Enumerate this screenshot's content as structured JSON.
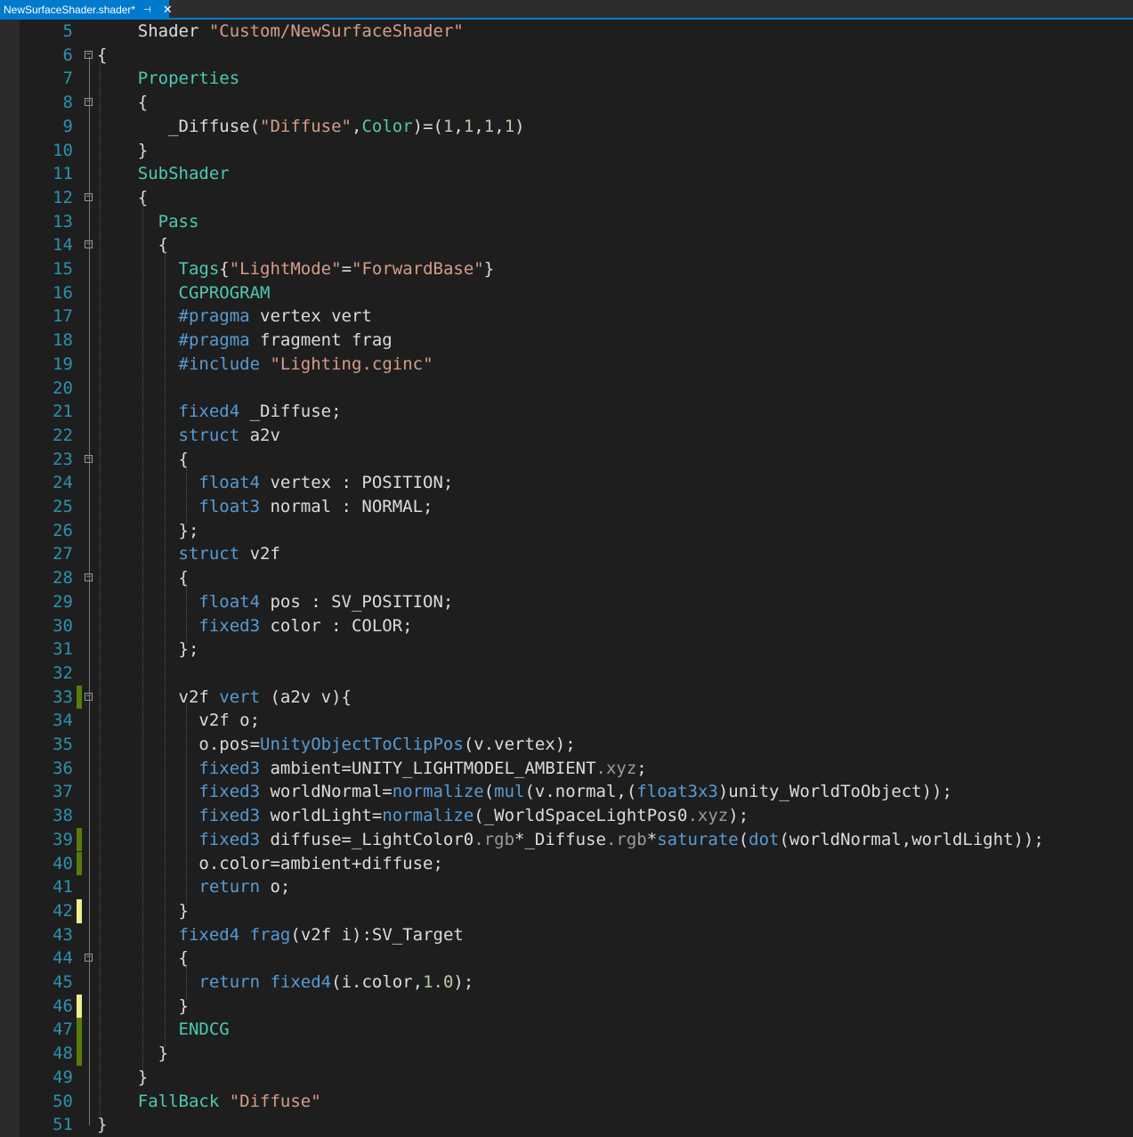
{
  "tab": {
    "title": "NewSurfaceShader.shader*",
    "pin_glyph": "⊣",
    "close_glyph": "✕"
  },
  "lines": [
    {
      "n": "5",
      "fold": null,
      "change": null,
      "tokens": [
        [
          "",
          "    "
        ],
        [
          "",
          "Shader "
        ],
        [
          "s",
          "\"Custom/NewSurfaceShader\""
        ]
      ]
    },
    {
      "n": "6",
      "fold": "⊟",
      "change": null,
      "tokens": [
        [
          "",
          "{"
        ]
      ]
    },
    {
      "n": "7",
      "fold": null,
      "change": null,
      "tokens": [
        [
          "",
          "    "
        ],
        [
          "t",
          "Properties"
        ]
      ]
    },
    {
      "n": "8",
      "fold": "⊟",
      "change": null,
      "tokens": [
        [
          "",
          "    {"
        ]
      ]
    },
    {
      "n": "9",
      "fold": null,
      "change": null,
      "tokens": [
        [
          "",
          "       "
        ],
        [
          "",
          "_Diffuse("
        ],
        [
          "s",
          "\"Diffuse\""
        ],
        [
          "",
          ","
        ],
        [
          "t",
          "Color"
        ],
        [
          "",
          ")=("
        ],
        [
          "n",
          "1"
        ],
        [
          "",
          ","
        ],
        [
          "n",
          "1"
        ],
        [
          "",
          ","
        ],
        [
          "n",
          "1"
        ],
        [
          "",
          ","
        ],
        [
          "n",
          "1"
        ],
        [
          "",
          ")"
        ]
      ]
    },
    {
      "n": "10",
      "fold": null,
      "change": null,
      "tokens": [
        [
          "",
          "    }"
        ]
      ]
    },
    {
      "n": "11",
      "fold": null,
      "change": null,
      "tokens": [
        [
          "",
          "    "
        ],
        [
          "t",
          "SubShader"
        ]
      ]
    },
    {
      "n": "12",
      "fold": "⊟",
      "change": null,
      "tokens": [
        [
          "",
          "    {"
        ]
      ]
    },
    {
      "n": "13",
      "fold": null,
      "change": null,
      "tokens": [
        [
          "",
          "      "
        ],
        [
          "t",
          "Pass"
        ]
      ]
    },
    {
      "n": "14",
      "fold": "⊟",
      "change": null,
      "tokens": [
        [
          "",
          "      {"
        ]
      ]
    },
    {
      "n": "15",
      "fold": null,
      "change": null,
      "tokens": [
        [
          "",
          "        "
        ],
        [
          "t",
          "Tags"
        ],
        [
          "",
          "{"
        ],
        [
          "s",
          "\"LightMode\""
        ],
        [
          "",
          "="
        ],
        [
          "s",
          "\"ForwardBase\""
        ],
        [
          "",
          "}"
        ]
      ]
    },
    {
      "n": "16",
      "fold": null,
      "change": null,
      "tokens": [
        [
          "",
          "        "
        ],
        [
          "t",
          "CGPROGRAM"
        ]
      ]
    },
    {
      "n": "17",
      "fold": null,
      "change": null,
      "tokens": [
        [
          "",
          "        "
        ],
        [
          "k",
          "#pragma"
        ],
        [
          "",
          " vertex vert"
        ]
      ]
    },
    {
      "n": "18",
      "fold": null,
      "change": null,
      "tokens": [
        [
          "",
          "        "
        ],
        [
          "k",
          "#pragma"
        ],
        [
          "",
          " fragment frag"
        ]
      ]
    },
    {
      "n": "19",
      "fold": null,
      "change": null,
      "tokens": [
        [
          "",
          "        "
        ],
        [
          "k",
          "#include"
        ],
        [
          "",
          " "
        ],
        [
          "s",
          "\"Lighting.cginc\""
        ]
      ]
    },
    {
      "n": "20",
      "fold": null,
      "change": null,
      "tokens": []
    },
    {
      "n": "21",
      "fold": null,
      "change": null,
      "tokens": [
        [
          "",
          "        "
        ],
        [
          "k",
          "fixed4"
        ],
        [
          "",
          " _Diffuse;"
        ]
      ]
    },
    {
      "n": "22",
      "fold": null,
      "change": null,
      "tokens": [
        [
          "",
          "        "
        ],
        [
          "k",
          "struct"
        ],
        [
          "",
          " a2v"
        ]
      ]
    },
    {
      "n": "23",
      "fold": "⊟",
      "change": null,
      "tokens": [
        [
          "",
          "        {"
        ]
      ]
    },
    {
      "n": "24",
      "fold": null,
      "change": null,
      "tokens": [
        [
          "",
          "          "
        ],
        [
          "k",
          "float4"
        ],
        [
          "",
          " vertex : POSITION;"
        ]
      ]
    },
    {
      "n": "25",
      "fold": null,
      "change": null,
      "tokens": [
        [
          "",
          "          "
        ],
        [
          "k",
          "float3"
        ],
        [
          "",
          " normal : NORMAL;"
        ]
      ]
    },
    {
      "n": "26",
      "fold": null,
      "change": null,
      "tokens": [
        [
          "",
          "        };"
        ]
      ]
    },
    {
      "n": "27",
      "fold": null,
      "change": null,
      "tokens": [
        [
          "",
          "        "
        ],
        [
          "k",
          "struct"
        ],
        [
          "",
          " v2f"
        ]
      ]
    },
    {
      "n": "28",
      "fold": "⊟",
      "change": null,
      "tokens": [
        [
          "",
          "        {"
        ]
      ]
    },
    {
      "n": "29",
      "fold": null,
      "change": null,
      "tokens": [
        [
          "",
          "          "
        ],
        [
          "k",
          "float4"
        ],
        [
          "",
          " pos : SV_POSITION;"
        ]
      ]
    },
    {
      "n": "30",
      "fold": null,
      "change": null,
      "tokens": [
        [
          "",
          "          "
        ],
        [
          "k",
          "fixed3"
        ],
        [
          "",
          " color : COLOR;"
        ]
      ]
    },
    {
      "n": "31",
      "fold": null,
      "change": null,
      "tokens": [
        [
          "",
          "        };"
        ]
      ]
    },
    {
      "n": "32",
      "fold": null,
      "change": null,
      "tokens": []
    },
    {
      "n": "33",
      "fold": "⊟",
      "change": "saved",
      "tokens": [
        [
          "",
          "        v2f "
        ],
        [
          "k",
          "vert"
        ],
        [
          "",
          " (a2v v){"
        ]
      ]
    },
    {
      "n": "34",
      "fold": null,
      "change": null,
      "tokens": [
        [
          "",
          "          v2f o;"
        ]
      ]
    },
    {
      "n": "35",
      "fold": null,
      "change": null,
      "tokens": [
        [
          "",
          "          o.pos="
        ],
        [
          "f",
          "UnityObjectToClipPos"
        ],
        [
          "",
          "(v.vertex);"
        ]
      ]
    },
    {
      "n": "36",
      "fold": null,
      "change": null,
      "tokens": [
        [
          "",
          "          "
        ],
        [
          "k",
          "fixed3"
        ],
        [
          "",
          " ambient=UNITY_LIGHTMODEL_AMBIENT"
        ],
        [
          "m",
          ".xyz"
        ],
        [
          "",
          ";"
        ]
      ]
    },
    {
      "n": "37",
      "fold": null,
      "change": null,
      "tokens": [
        [
          "",
          "          "
        ],
        [
          "k",
          "fixed3"
        ],
        [
          "",
          " worldNormal="
        ],
        [
          "f",
          "normalize"
        ],
        [
          "",
          "("
        ],
        [
          "f",
          "mul"
        ],
        [
          "",
          "(v.normal,("
        ],
        [
          "k",
          "float3x3"
        ],
        [
          "",
          ")unity_WorldToObject));"
        ]
      ]
    },
    {
      "n": "38",
      "fold": null,
      "change": null,
      "tokens": [
        [
          "",
          "          "
        ],
        [
          "k",
          "fixed3"
        ],
        [
          "",
          " worldLight="
        ],
        [
          "f",
          "normalize"
        ],
        [
          "",
          "(_WorldSpaceLightPos0"
        ],
        [
          "m",
          ".xyz"
        ],
        [
          "",
          ");"
        ]
      ]
    },
    {
      "n": "39",
      "fold": null,
      "change": "saved",
      "tokens": [
        [
          "",
          "          "
        ],
        [
          "k",
          "fixed3"
        ],
        [
          "",
          " diffuse=_LightColor0"
        ],
        [
          "m",
          ".rgb"
        ],
        [
          "",
          "*_Diffuse"
        ],
        [
          "m",
          ".rgb"
        ],
        [
          "",
          "*"
        ],
        [
          "f",
          "saturate"
        ],
        [
          "",
          "("
        ],
        [
          "f",
          "dot"
        ],
        [
          "",
          "(worldNormal,worldLight));"
        ]
      ]
    },
    {
      "n": "40",
      "fold": null,
      "change": "saved",
      "tokens": [
        [
          "",
          "          o.color=ambient+diffuse;"
        ]
      ]
    },
    {
      "n": "41",
      "fold": null,
      "change": null,
      "tokens": [
        [
          "",
          "          "
        ],
        [
          "k",
          "return"
        ],
        [
          "",
          " o;"
        ]
      ]
    },
    {
      "n": "42",
      "fold": null,
      "change": "unsaved",
      "tokens": [
        [
          "",
          "        }"
        ]
      ]
    },
    {
      "n": "43",
      "fold": null,
      "change": null,
      "tokens": [
        [
          "",
          "        "
        ],
        [
          "k",
          "fixed4"
        ],
        [
          "",
          " "
        ],
        [
          "k",
          "frag"
        ],
        [
          "",
          "(v2f i):SV_Target"
        ]
      ]
    },
    {
      "n": "44",
      "fold": "⊟",
      "change": null,
      "tokens": [
        [
          "",
          "        {"
        ]
      ]
    },
    {
      "n": "45",
      "fold": null,
      "change": null,
      "tokens": [
        [
          "",
          "          "
        ],
        [
          "k",
          "return"
        ],
        [
          "",
          " "
        ],
        [
          "k",
          "fixed4"
        ],
        [
          "",
          "(i.color,"
        ],
        [
          "n",
          "1.0"
        ],
        [
          "",
          ");"
        ]
      ]
    },
    {
      "n": "46",
      "fold": null,
      "change": "unsaved",
      "tokens": [
        [
          "",
          "        }"
        ]
      ]
    },
    {
      "n": "47",
      "fold": null,
      "change": "saved",
      "tokens": [
        [
          "",
          "        "
        ],
        [
          "t",
          "ENDCG"
        ]
      ]
    },
    {
      "n": "48",
      "fold": null,
      "change": "saved",
      "tokens": [
        [
          "",
          "      }"
        ]
      ]
    },
    {
      "n": "49",
      "fold": null,
      "change": null,
      "tokens": [
        [
          "",
          "    }"
        ]
      ]
    },
    {
      "n": "50",
      "fold": null,
      "change": null,
      "tokens": [
        [
          "",
          "    "
        ],
        [
          "t",
          "FallBack"
        ],
        [
          "",
          " "
        ],
        [
          "s",
          "\"Diffuse\""
        ]
      ]
    },
    {
      "n": "51",
      "fold": null,
      "change": null,
      "tokens": [
        [
          "",
          "}"
        ]
      ]
    }
  ]
}
